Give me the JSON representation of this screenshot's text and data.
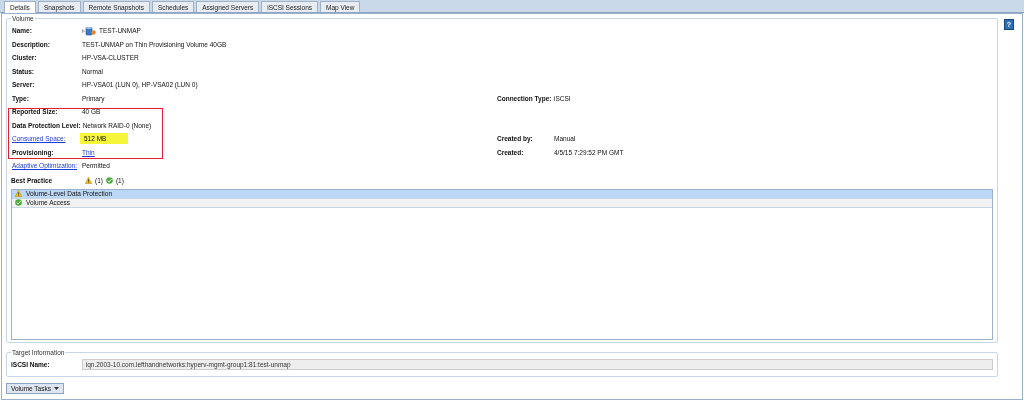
{
  "tabs": [
    {
      "label": "Details",
      "selected": true
    },
    {
      "label": "Snapshots",
      "selected": false
    },
    {
      "label": "Remote Snapshots",
      "selected": false
    },
    {
      "label": "Schedules",
      "selected": false
    },
    {
      "label": "Assigned Servers",
      "selected": false
    },
    {
      "label": "iSCSI Sessions",
      "selected": false
    },
    {
      "label": "Map View",
      "selected": false
    }
  ],
  "help": "?",
  "volume": {
    "legend": "Volume",
    "rows": [
      {
        "kind": "volume-name",
        "label": "Name:",
        "value": "TEST-UNMAP",
        "boxed": false,
        "highlighted": false
      },
      {
        "kind": "plain",
        "label": "Description:",
        "value": "TEST-UNMAP on Thin Provisioning Volume 40GB",
        "boxed": false,
        "highlighted": false
      },
      {
        "kind": "plain",
        "label": "Cluster:",
        "value": "HP-VSA-CLUSTER",
        "boxed": false,
        "highlighted": false
      },
      {
        "kind": "plain",
        "label": "Status:",
        "value": "Normal",
        "boxed": false,
        "highlighted": false
      },
      {
        "kind": "plain",
        "label": "Server:",
        "value": "HP-VSA01 (LUN 0), HP-VSA02 (LUN 0)",
        "boxed": false,
        "highlighted": false
      },
      {
        "kind": "plain",
        "label": "Type:",
        "value": "Primary",
        "boxed": false,
        "highlighted": false,
        "right": {
          "label": "Connection Type:",
          "value": "iSCSI"
        }
      },
      {
        "kind": "plain",
        "label": "Reported Size:",
        "value": "40 GB",
        "boxed": true,
        "highlighted": false
      },
      {
        "kind": "plain",
        "label": "Data Protection Level:",
        "value": "Network RAID-0 (None)",
        "boxed": true,
        "highlighted": false
      },
      {
        "kind": "link-label",
        "label": "Consumed Space:",
        "value": "512 MB",
        "boxed": true,
        "highlighted": true,
        "right": {
          "label": "Created by:",
          "value": "Manual"
        }
      },
      {
        "kind": "link-value",
        "label": "Provisioning:",
        "value": "Thin",
        "boxed": true,
        "highlighted": false,
        "right": {
          "label": "Created:",
          "value": "4/5/15 7:29:52 PM GMT"
        }
      },
      {
        "kind": "link-label",
        "label": "Adaptive Optimization:",
        "value": "Permitted",
        "boxed": false,
        "highlighted": false
      }
    ]
  },
  "best_practice": {
    "label": "Best Practice",
    "warning_count": "(1)",
    "ok_count": "(1)",
    "items": [
      {
        "kind": "warning",
        "text": "Volume-Level Data Protection",
        "selected": true
      },
      {
        "kind": "ok",
        "text": "Volume Access",
        "selected": false
      }
    ]
  },
  "target": {
    "legend": "Target Information",
    "label": "iSCSI Name:",
    "value": "iqn.2003-10.com.lefthandnetworks:hyperv-mgmt-group1:81:test-unmap"
  },
  "volume_tasks": "Volume Tasks"
}
